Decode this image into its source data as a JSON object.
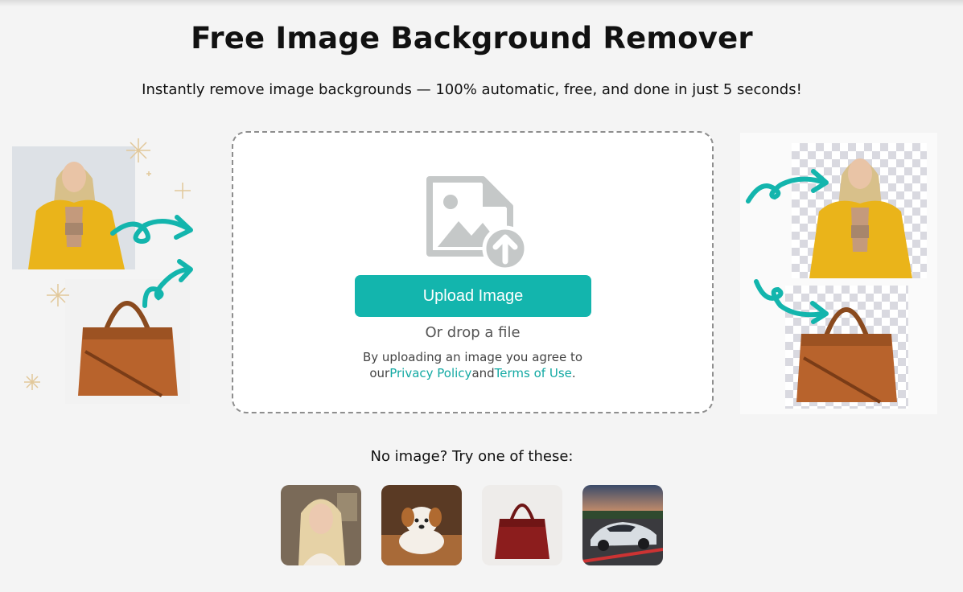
{
  "header": {
    "title": "Free Image Background Remover",
    "subtitle": "Instantly remove image backgrounds — 100% automatic, free, and done in just 5 seconds!"
  },
  "upload": {
    "button_label": "Upload Image",
    "drop_text": "Or drop a file",
    "agree_line1": "By uploading an image you agree to",
    "agree_prefix": "our",
    "privacy_link": "Privacy Policy",
    "and_text": "and",
    "terms_link": "Terms of Use",
    "period": "."
  },
  "samples": {
    "label": "No image? Try one of these:",
    "items": [
      {
        "icon": "woman-portrait-thumbnail"
      },
      {
        "icon": "puppy-thumbnail"
      },
      {
        "icon": "red-handbag-thumbnail"
      },
      {
        "icon": "sports-car-thumbnail"
      }
    ]
  },
  "colors": {
    "accent": "#13b5ad",
    "link": "#13a9a3",
    "background": "#f4f4f4"
  }
}
